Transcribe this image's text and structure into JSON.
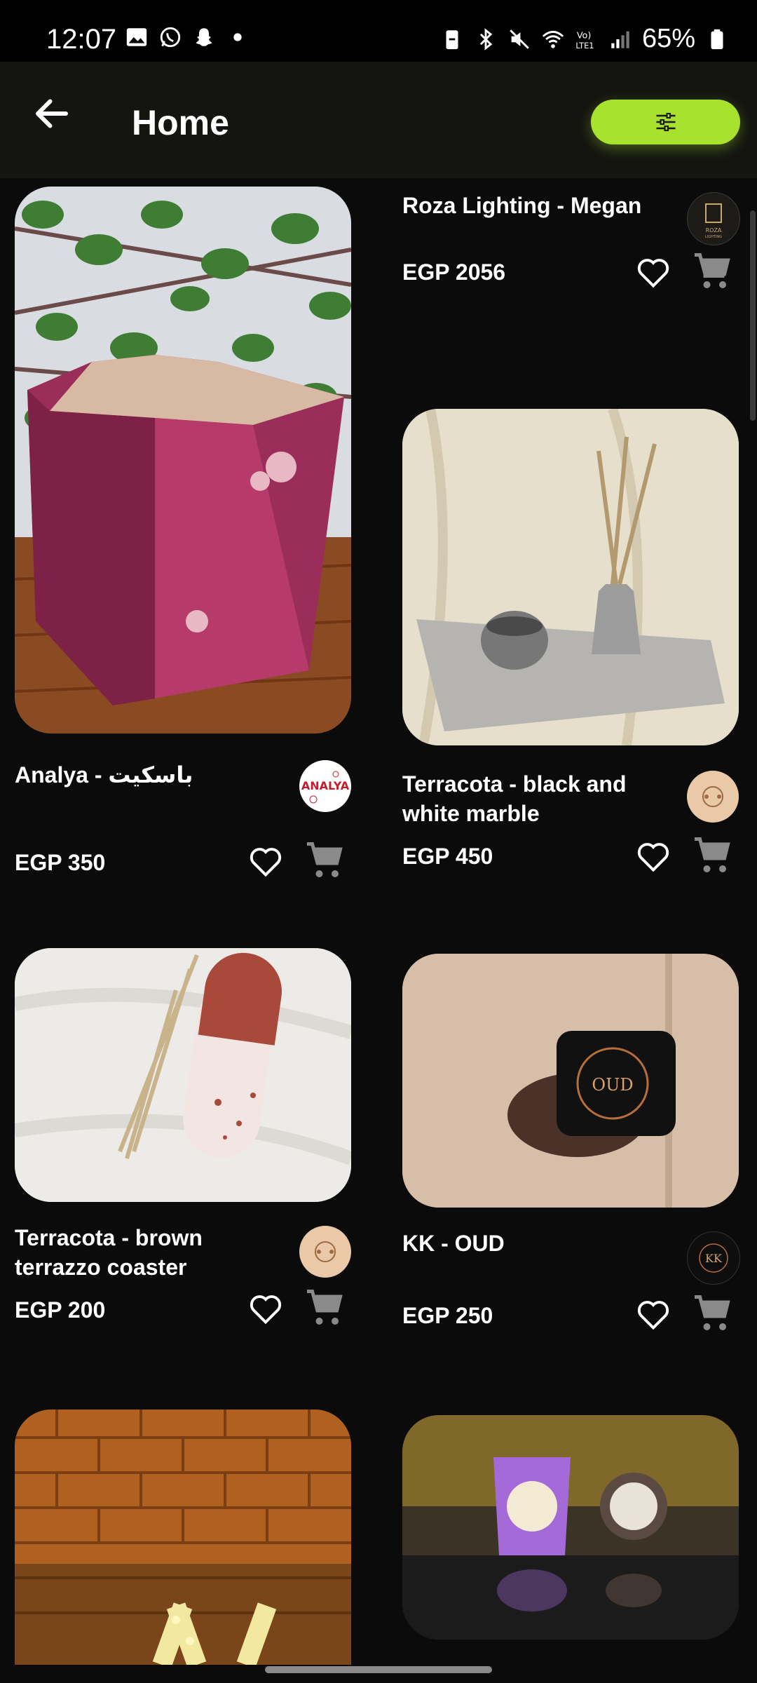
{
  "status_bar": {
    "time": "12:07",
    "battery": "65%",
    "left_icons": [
      "gallery-icon",
      "whatsapp-icon",
      "snapchat-icon",
      "dot-icon"
    ],
    "right_icons": [
      "battery-saver-icon",
      "bluetooth-icon",
      "mute-icon",
      "wifi-icon",
      "volte-icon",
      "signal-icon",
      "battery-icon"
    ]
  },
  "app_bar": {
    "title": "Home",
    "back_icon": "arrow-left-icon",
    "filter_icon": "sliders-icon",
    "filter_color": "#a8e22e"
  },
  "products": [
    {
      "name": "Roza Lighting - Megan",
      "price": "EGP 2056",
      "logo_text": "ROZA LIGHTING"
    },
    {
      "name": "Analya - باسكيت",
      "price": "EGP 350",
      "logo_text": "ANALYA"
    },
    {
      "name": "Terracota - black and white marble",
      "price": "EGP 450",
      "logo_text": ""
    },
    {
      "name": "Terracota - brown terrazzo coaster",
      "price": "EGP 200",
      "logo_text": ""
    },
    {
      "name": "KK - OUD",
      "price": "EGP 250",
      "logo_text": "KK"
    },
    {
      "name": "",
      "price": "",
      "logo_text": ""
    },
    {
      "name": "",
      "price": "",
      "logo_text": ""
    }
  ],
  "colors": {
    "background": "#0b0b0b",
    "appbar": "#141510",
    "accent": "#a8e22e"
  }
}
